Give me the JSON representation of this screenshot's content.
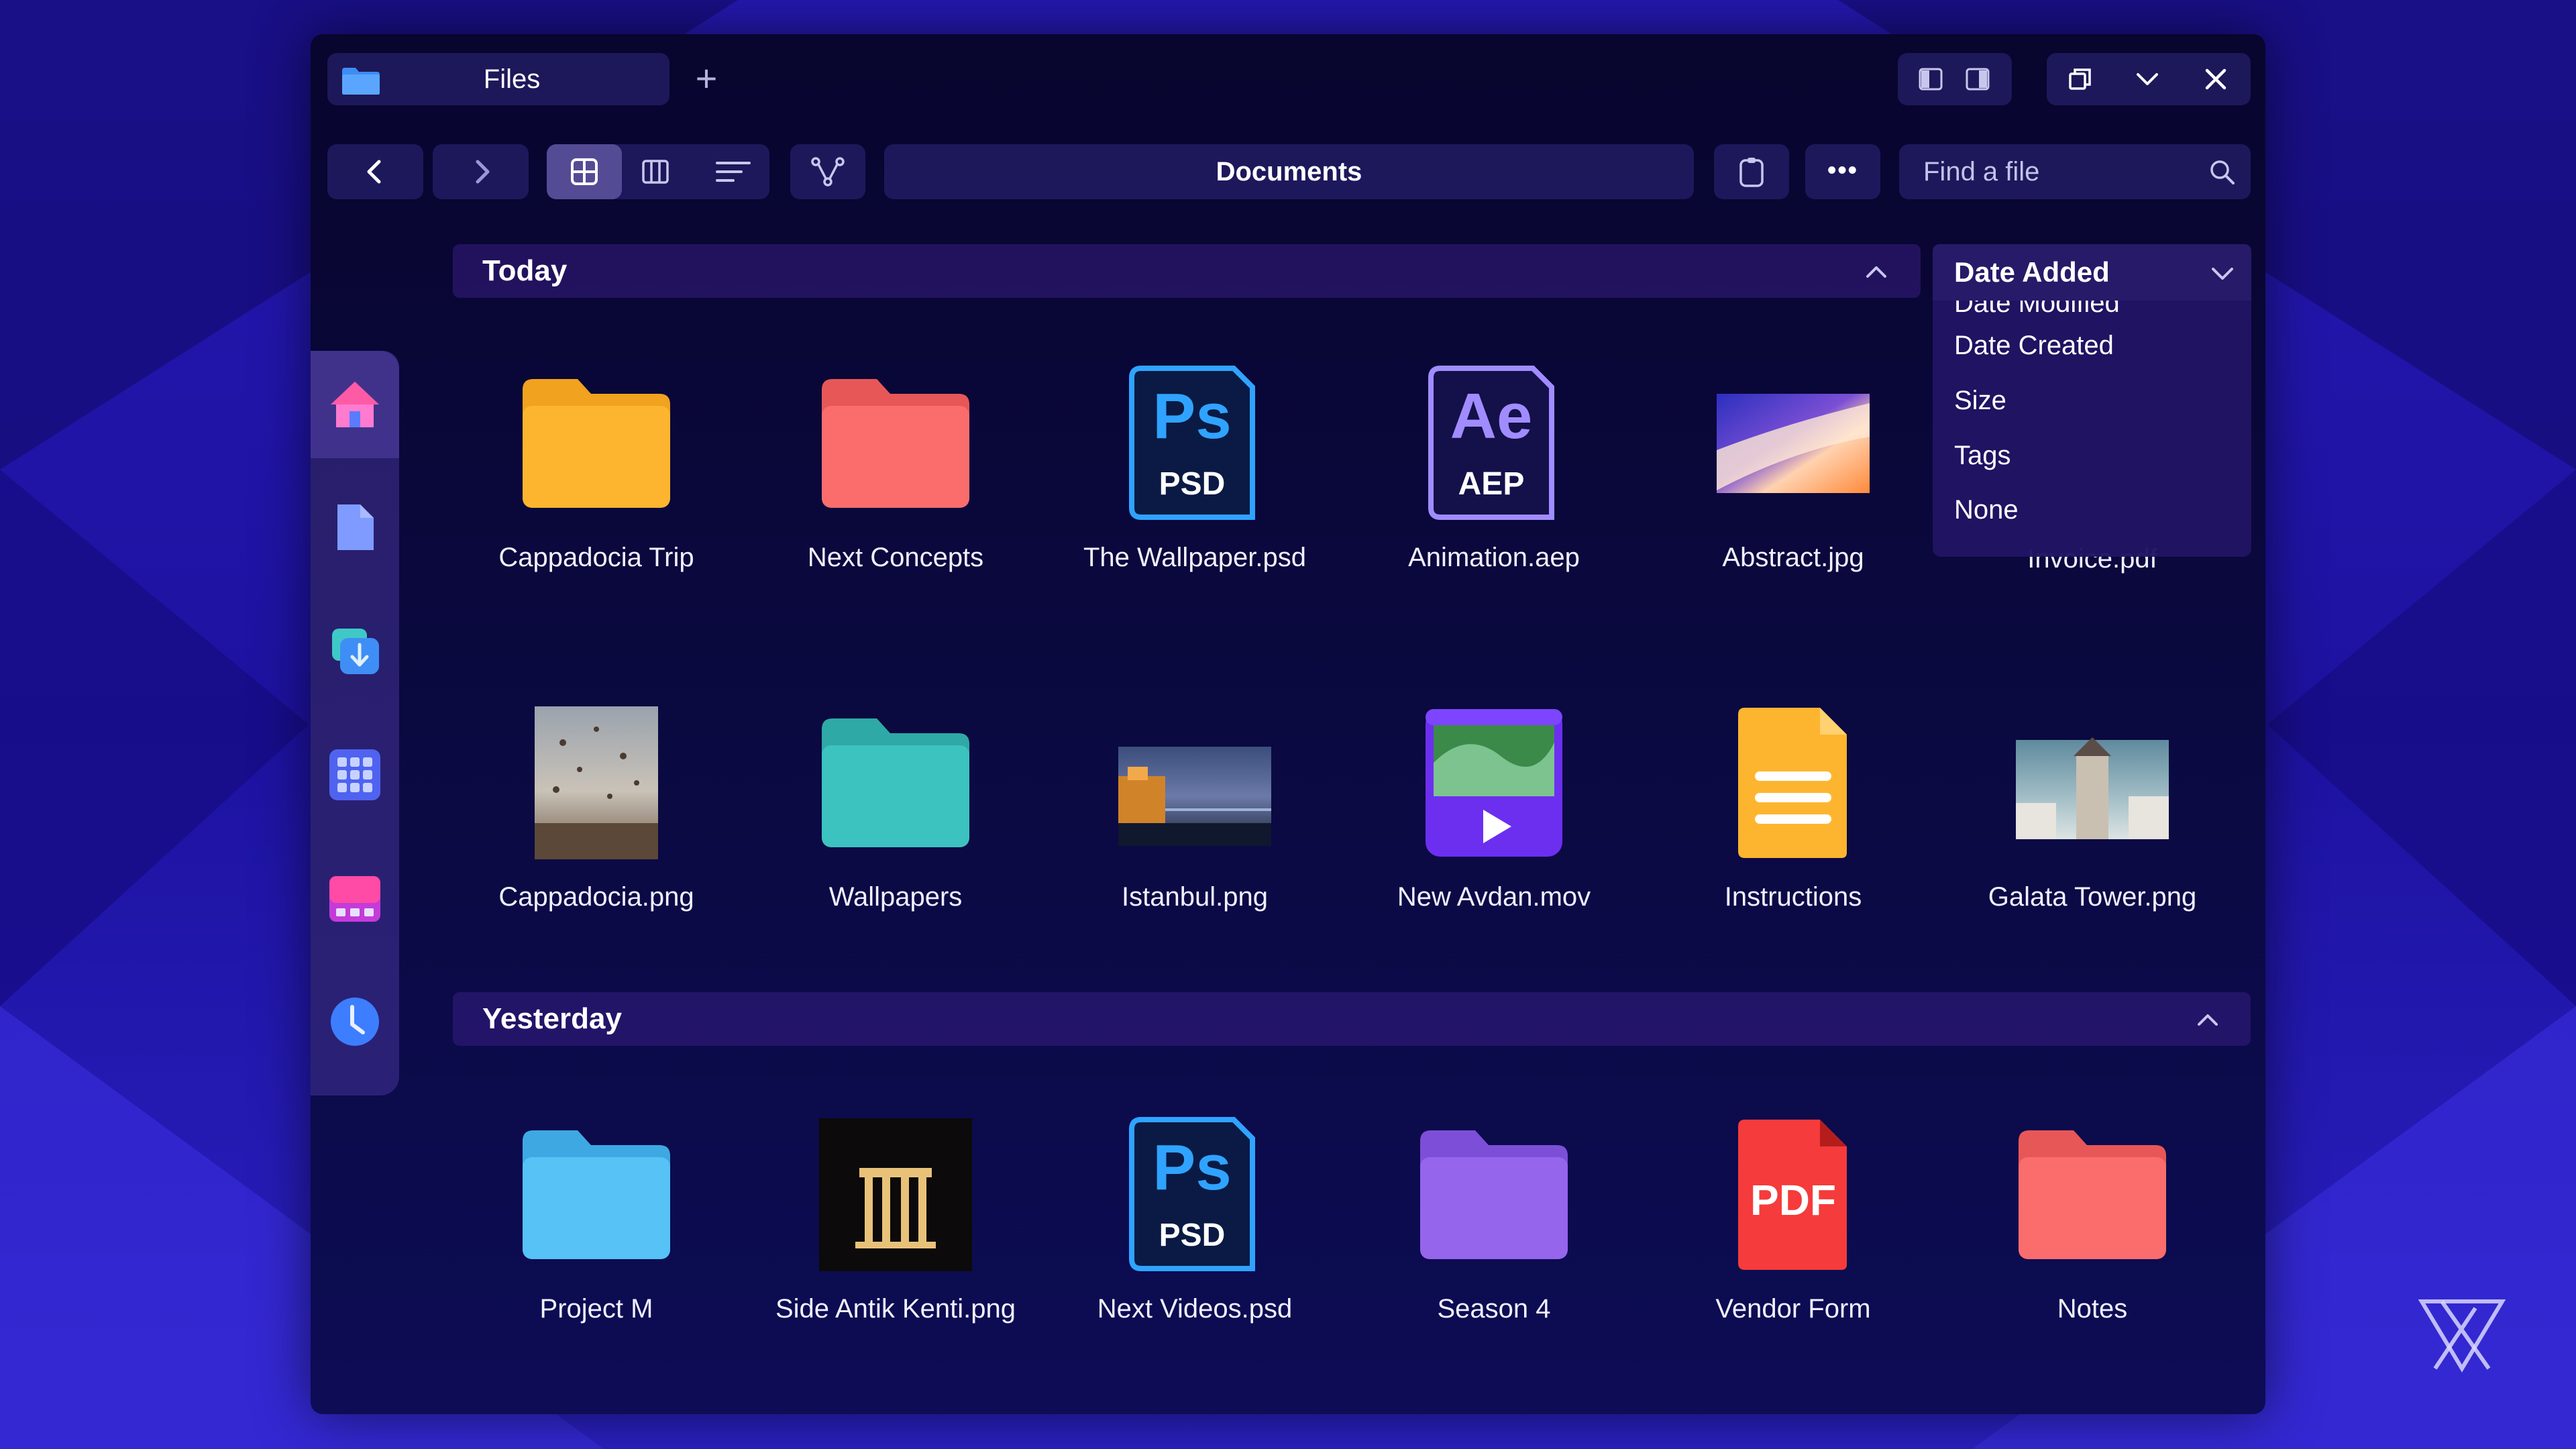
{
  "window": {
    "tab_title": "Files",
    "new_tab_symbol": "+"
  },
  "toolbar": {
    "path": "Documents",
    "search_placeholder": "Find a file",
    "more_symbol": "•••"
  },
  "sort": {
    "selected": "Date Added",
    "options": [
      "Date Modified",
      "Date Created",
      "Size",
      "Tags",
      "None"
    ]
  },
  "sections": {
    "today": {
      "label": "Today",
      "files": [
        {
          "name": "Cappadocia Trip",
          "icon": "folder-icon",
          "color": "#fdb52f"
        },
        {
          "name": "Next Concepts",
          "icon": "folder-icon",
          "color": "#fb6d6d"
        },
        {
          "name": "The Wallpaper.psd",
          "icon": "photoshop-file-icon",
          "badge": "Ps",
          "ext": "PSD"
        },
        {
          "name": "Animation.aep",
          "icon": "after-effects-file-icon",
          "badge": "Ae",
          "ext": "AEP"
        },
        {
          "name": "Abstract.jpg",
          "icon": "image-thumbnail-icon"
        },
        {
          "name": "Invoice.pdf",
          "icon": "pdf-file-icon"
        },
        {
          "name": "Cappadocia.png",
          "icon": "image-thumbnail-icon"
        },
        {
          "name": "Wallpapers",
          "icon": "folder-icon",
          "color": "#3cc3c0"
        },
        {
          "name": "Istanbul.png",
          "icon": "image-thumbnail-icon"
        },
        {
          "name": "New Avdan.mov",
          "icon": "video-file-icon"
        },
        {
          "name": "Instructions",
          "icon": "document-icon",
          "color": "#fdb52f"
        },
        {
          "name": "Galata Tower.png",
          "icon": "image-thumbnail-icon"
        }
      ]
    },
    "yesterday": {
      "label": "Yesterday",
      "files": [
        {
          "name": "Project M",
          "icon": "folder-icon",
          "color": "#56c2f5"
        },
        {
          "name": "Side Antik Kenti.png",
          "icon": "image-thumbnail-icon"
        },
        {
          "name": "Next Videos.psd",
          "icon": "photoshop-file-icon",
          "badge": "Ps",
          "ext": "PSD"
        },
        {
          "name": "Season 4",
          "icon": "folder-icon",
          "color": "#9565ec"
        },
        {
          "name": "Vendor Form",
          "icon": "pdf-file-icon",
          "badge": "PDF"
        },
        {
          "name": "Notes",
          "icon": "folder-icon",
          "color": "#fb6d6d"
        }
      ]
    }
  },
  "sidebar": {
    "items": [
      {
        "icon": "home-icon",
        "active": true
      },
      {
        "icon": "document-icon"
      },
      {
        "icon": "downloads-icon"
      },
      {
        "icon": "apps-grid-icon"
      },
      {
        "icon": "media-icon"
      },
      {
        "icon": "recent-clock-icon"
      }
    ]
  },
  "colors": {
    "background": "#1a0f8f",
    "window": "#08052e",
    "accent": "#4f7dff"
  }
}
